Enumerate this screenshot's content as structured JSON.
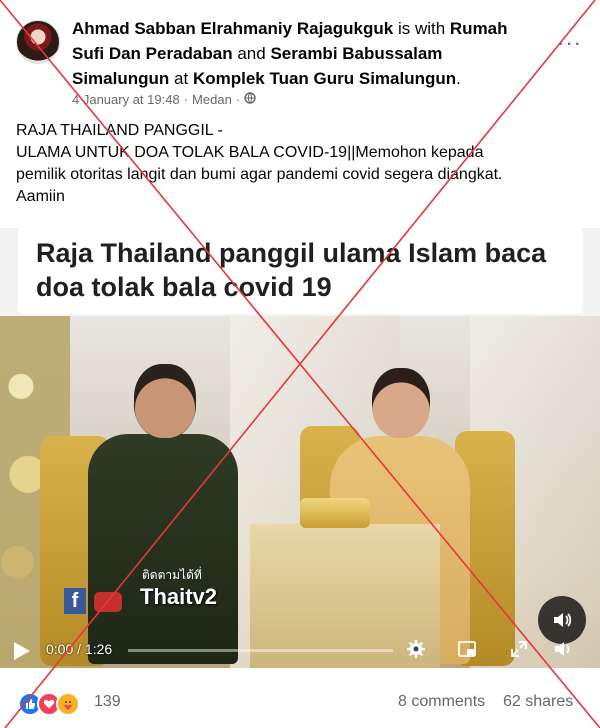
{
  "post": {
    "author": "Ahmad Sabban Elrahmaniy Rajagukguk",
    "with_text": "is with",
    "tag1": "Rumah Sufi Dan Peradaban",
    "and_text": "and",
    "tag2": "Serambi Babussalam Simalungun",
    "at_text": "at",
    "location_tag": "Komplek Tuan Guru Simalungun",
    "period": ".",
    "date": "4 January at 19:48",
    "place": "Medan",
    "sep": "·",
    "more_label": "···"
  },
  "body": {
    "line1": "RAJA THAILAND PANGGIL -",
    "line2": "ULAMA UNTUK DOA TOLAK BALA COVID-19||Memohon kepada",
    "line3": "pemilik otoritas langit dan bumi agar pandemi covid segera diangkat.",
    "line4": "Aamiin"
  },
  "media": {
    "headline": "Raja Thailand panggil ulama Islam baca doa tolak bala covid 19",
    "watermark_small": "ติดตามได้ที่",
    "watermark_name": "Thaitv2",
    "watermark_f": "f"
  },
  "player": {
    "time": "0:00 / 1:26",
    "progress": 0,
    "play_icon": "play-icon",
    "settings_icon": "gear-icon",
    "pip_icon": "picture-in-picture-icon",
    "fullscreen_icon": "fullscreen-icon",
    "volume_icon": "volume-icon"
  },
  "footer": {
    "reactions": [
      "like",
      "love",
      "care"
    ],
    "reaction_count": "139",
    "comments": "8 comments",
    "shares": "62 shares"
  },
  "colors": {
    "like": "#1877f2",
    "love": "#f33e58",
    "care": "#f7b125",
    "cross": "#e8363a",
    "link_text": "#050505",
    "secondary": "#65676b"
  }
}
